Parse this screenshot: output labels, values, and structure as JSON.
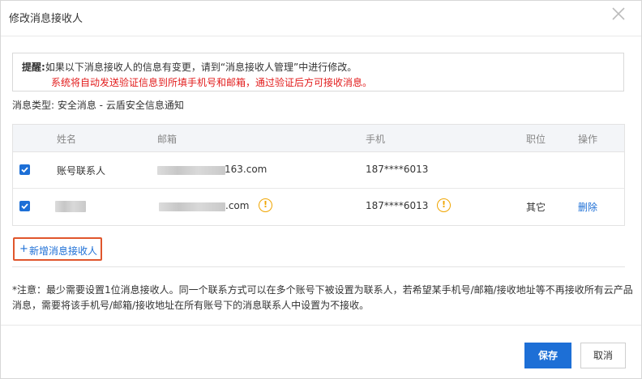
{
  "dialog": {
    "title": "修改消息接收人",
    "close_icon": "close-icon"
  },
  "notice": {
    "label": "提醒:",
    "line1": "如果以下消息接收人的信息有变更，请到“消息接收人管理”中进行修改。",
    "line2": "系统将自动发送验证信息到所填手机号和邮箱，通过验证后方可接收消息。",
    "line2_color": "#e21c1c"
  },
  "message_type": "消息类型: 安全消息 - 云盾安全信息通知",
  "table": {
    "headers": {
      "name": "姓名",
      "email": "邮箱",
      "phone": "手机",
      "position": "职位",
      "actions": "操作"
    },
    "rows": [
      {
        "checked": true,
        "name": "账号联系人",
        "email_suffix": "163.com",
        "phone": "187****6013",
        "position": "",
        "action": ""
      },
      {
        "checked": true,
        "name": "",
        "email_suffix": ".com",
        "email_warning_icon": "warning-icon",
        "phone": "187****6013",
        "phone_warning_icon": "warning-icon",
        "position": "其它",
        "action": "删除"
      }
    ]
  },
  "add_button": {
    "plus": "+",
    "label": "新增消息接收人",
    "highlight_color": "#e0562c"
  },
  "note": "*注意：最少需要设置1位消息接收人。同一个联系方式可以在多个账号下被设置为联系人，若希望某手机号/邮箱/接收地址等不再接收所有云产品消息，需要将该手机号/邮箱/接收地址在所有账号下的消息联系人中设置为不接收。",
  "footer": {
    "save_label": "保存",
    "cancel_label": "取消",
    "accent_color": "#1d6fd6"
  }
}
